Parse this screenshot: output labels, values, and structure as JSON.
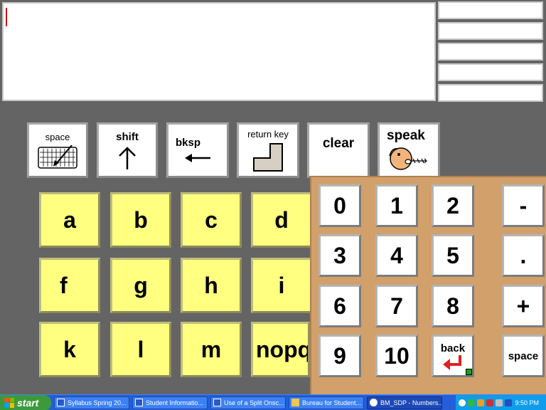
{
  "controls": {
    "space": "space",
    "shift": "shift",
    "bksp": "bksp",
    "return_key": "return key",
    "clear": "clear",
    "speak": "speak"
  },
  "letters": [
    "a",
    "b",
    "c",
    "d",
    "f",
    "g",
    "h",
    "i",
    "k",
    "l",
    "m",
    "nopq"
  ],
  "numpad": {
    "digits": [
      "0",
      "1",
      "2",
      "3",
      "4",
      "5",
      "6",
      "7",
      "8",
      "9",
      "10"
    ],
    "symbols": [
      "-",
      ".",
      "+"
    ],
    "back": "back",
    "space": "space"
  },
  "taskbar": {
    "start": "start",
    "tasks": [
      "Syllabus Spring 20...",
      "Student Informatio...",
      "Use of a Split Onsc...",
      "Bureau for Student...",
      "BM_SDP - Numbers..."
    ],
    "clock": "9:50 PM"
  },
  "colors": {
    "background": "#646464",
    "letter_key": "#ffff80",
    "numpad_panel": "#d1a06b",
    "taskbar": "#245edb"
  }
}
